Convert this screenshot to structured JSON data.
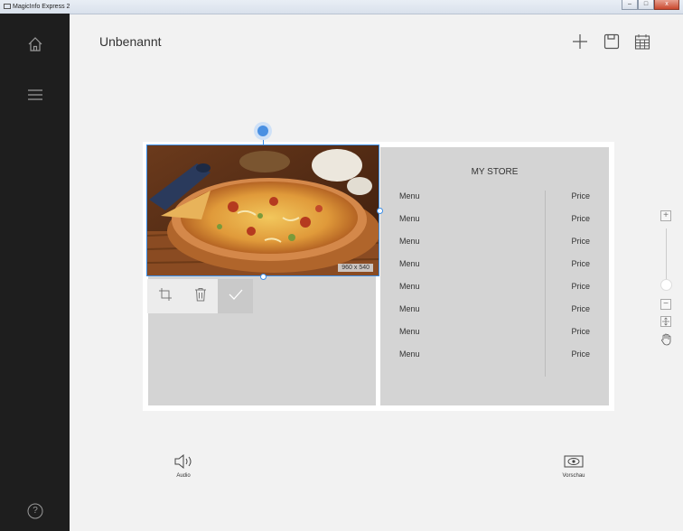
{
  "window": {
    "title": "MagicInfo Express 2",
    "minimize": "–",
    "maximize": "□",
    "close": "x"
  },
  "sidebar": {
    "items": [
      {
        "icon": "home-icon"
      },
      {
        "icon": "menu-icon"
      },
      {
        "icon": "help-icon",
        "label": "?"
      }
    ]
  },
  "header": {
    "title": "Unbenannt",
    "actions": [
      {
        "icon": "add-icon"
      },
      {
        "icon": "save-icon"
      },
      {
        "icon": "calendar-icon"
      }
    ]
  },
  "canvas": {
    "image_size_label": "960 x 540",
    "store_title": "MY STORE",
    "menu_items": [
      {
        "name": "Menu",
        "price": "Price"
      },
      {
        "name": "Menu",
        "price": "Price"
      },
      {
        "name": "Menu",
        "price": "Price"
      },
      {
        "name": "Menu",
        "price": "Price"
      },
      {
        "name": "Menu",
        "price": "Price"
      },
      {
        "name": "Menu",
        "price": "Price"
      },
      {
        "name": "Menu",
        "price": "Price"
      },
      {
        "name": "Menu",
        "price": "Price"
      }
    ]
  },
  "image_toolbar": [
    {
      "icon": "crop-icon"
    },
    {
      "icon": "trash-icon"
    },
    {
      "icon": "check-icon"
    }
  ],
  "zoom": {
    "zoom_in": "+",
    "zoom_out": "−"
  },
  "bottom": {
    "audio_label": "Audio",
    "preview_label": "Vorschau"
  },
  "colors": {
    "sidebar": "#1e1e1e",
    "accent": "#3b8ee8",
    "zone": "#d4d4d4"
  }
}
